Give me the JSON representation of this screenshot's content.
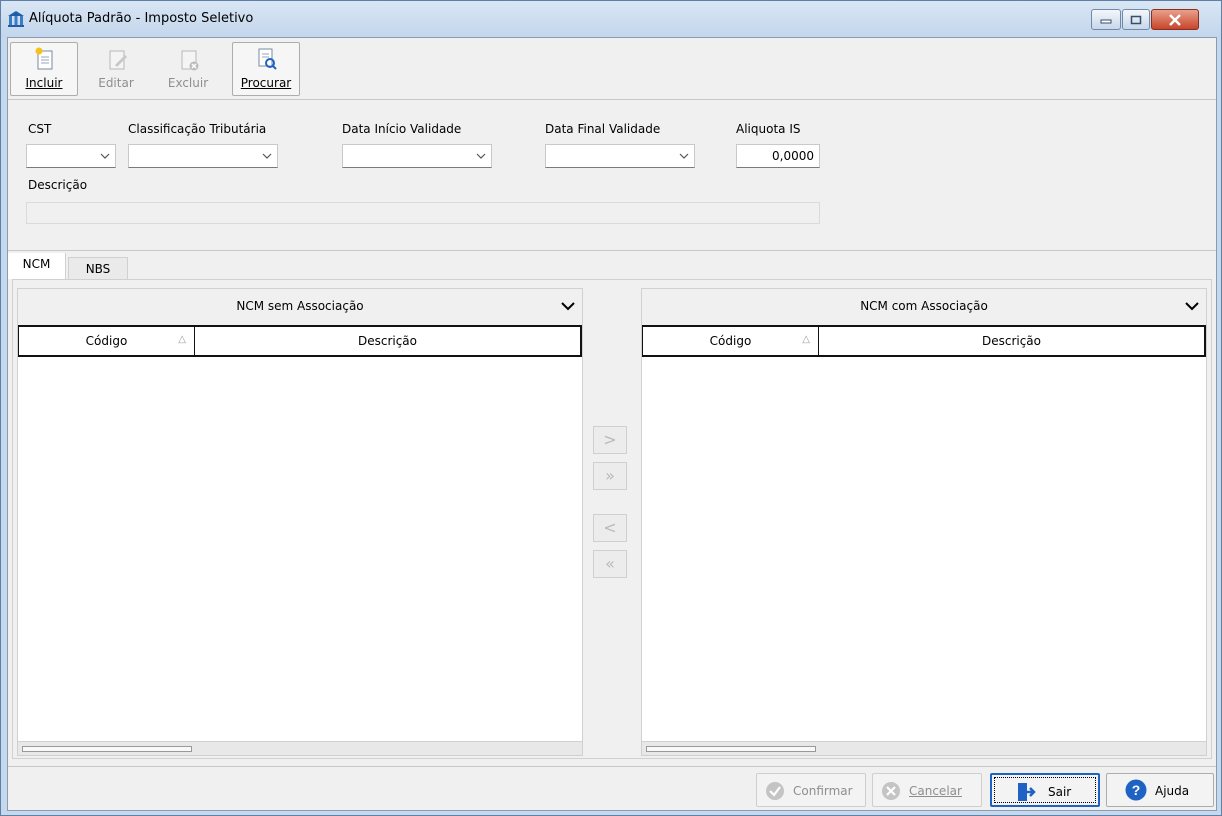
{
  "window": {
    "title": "Alíquota Padrão - Imposto Seletivo"
  },
  "toolbar": {
    "incluir": "Incluir",
    "editar": "Editar",
    "excluir": "Excluir",
    "procurar": "Procurar"
  },
  "form": {
    "cst_label": "CST",
    "cst_value": "",
    "classificacao_label": "Classificação Tributária",
    "classificacao_value": "",
    "data_inicio_label": "Data Início Validade",
    "data_inicio_value": "",
    "data_final_label": "Data Final Validade",
    "data_final_value": "",
    "aliquota_label": "Aliquota IS",
    "aliquota_value": "0,0000",
    "descricao_label": "Descrição",
    "descricao_value": ""
  },
  "tabs": [
    {
      "label": "NCM",
      "active": true
    },
    {
      "label": "NBS",
      "active": false
    }
  ],
  "left_panel": {
    "title": "NCM sem Associação",
    "columns": [
      "Código",
      "Descrição"
    ],
    "rows": []
  },
  "right_panel": {
    "title": "NCM com Associação",
    "columns": [
      "Código",
      "Descrição"
    ],
    "rows": []
  },
  "move_buttons": [
    ">",
    "»",
    "<",
    "«"
  ],
  "footer": {
    "confirmar": "Confirmar",
    "cancelar": "Cancelar",
    "sair": "Sair",
    "ajuda": "Ajuda"
  },
  "colors": {
    "title_bar": "#c3d6ec",
    "close_button": "#c7452a",
    "focus_border": "#1e63c4",
    "help_icon": "#1e63c4"
  }
}
